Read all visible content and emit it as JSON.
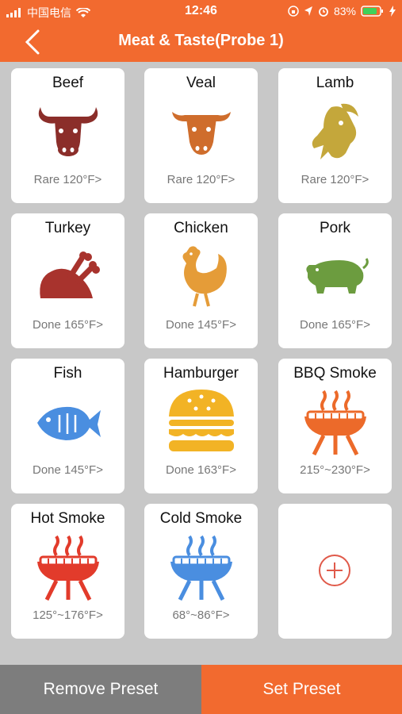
{
  "status": {
    "carrier": "中国电信",
    "time": "12:46",
    "battery": "83%"
  },
  "header": {
    "title": "Meat & Taste(Probe 1)"
  },
  "presets": [
    {
      "name": "Beef",
      "temp": "Rare 120°F>",
      "icon": "cow-icon",
      "color": "#8b2e2a"
    },
    {
      "name": "Veal",
      "temp": "Rare 120°F>",
      "icon": "calf-icon",
      "color": "#cf6d2c"
    },
    {
      "name": "Lamb",
      "temp": "Rare 120°F>",
      "icon": "goat-icon",
      "color": "#c4a73b"
    },
    {
      "name": "Turkey",
      "temp": "Done 165°F>",
      "icon": "turkey-icon",
      "color": "#a8332d"
    },
    {
      "name": "Chicken",
      "temp": "Done 145°F>",
      "icon": "chicken-icon",
      "color": "#e59c38"
    },
    {
      "name": "Pork",
      "temp": "Done 165°F>",
      "icon": "pig-icon",
      "color": "#6c9c3f"
    },
    {
      "name": "Fish",
      "temp": "Done 145°F>",
      "icon": "fish-icon",
      "color": "#4a8ee0"
    },
    {
      "name": "Hamburger",
      "temp": "Done 163°F>",
      "icon": "burger-icon",
      "color": "#f2b325"
    },
    {
      "name": "BBQ Smoke",
      "temp": "215°~230°F>",
      "icon": "grill-icon",
      "color": "#ec6a2a"
    },
    {
      "name": "Hot Smoke",
      "temp": "125°~176°F>",
      "icon": "grill-icon",
      "color": "#e23b2b"
    },
    {
      "name": "Cold Smoke",
      "temp": "68°~86°F>",
      "icon": "grill-icon",
      "color": "#4a8ee0"
    }
  ],
  "add_card": {
    "icon": "plus-circle-icon",
    "color": "#e05a4a"
  },
  "buttons": {
    "remove": "Remove Preset",
    "set": "Set Preset"
  }
}
